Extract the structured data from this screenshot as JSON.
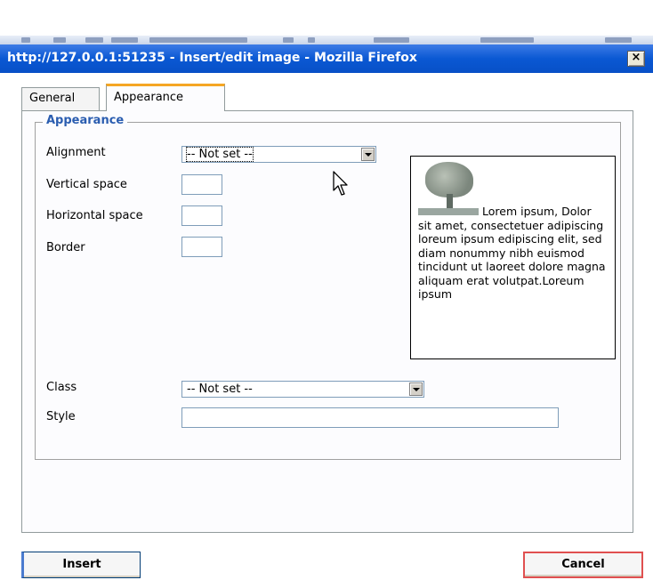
{
  "window": {
    "title": "http://127.0.0.1:51235 - Insert/edit image - Mozilla Firefox",
    "close_label": "×"
  },
  "tabs": [
    {
      "label": "General",
      "active": false
    },
    {
      "label": "Appearance",
      "active": true
    }
  ],
  "appearance": {
    "legend": "Appearance",
    "alignment": {
      "label": "Alignment",
      "value": "-- Not set --"
    },
    "vertical_space": {
      "label": "Vertical space",
      "value": ""
    },
    "horizontal_space": {
      "label": "Horizontal space",
      "value": ""
    },
    "border": {
      "label": "Border",
      "value": ""
    },
    "class": {
      "label": "Class",
      "value": "-- Not set --"
    },
    "style": {
      "label": "Style",
      "value": ""
    },
    "preview_text": "Lorem ipsum, Dolor sit amet, consectetuer adipiscing loreum ipsum edipiscing elit, sed diam nonummy nibh euismod tincidunt ut laoreet dolore magna aliquam erat volutpat.Loreum ipsum"
  },
  "buttons": {
    "insert": "Insert",
    "cancel": "Cancel"
  },
  "colors": {
    "titlebar": "#0a58d3",
    "legend": "#2a5db0",
    "active_tab_accent": "#f5a623",
    "cancel_border": "#e05050"
  }
}
